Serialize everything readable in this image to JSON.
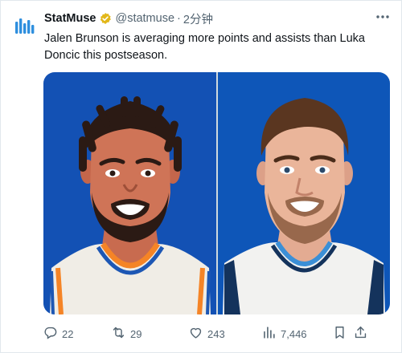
{
  "tweet": {
    "author_name": "StatMuse",
    "handle": "@statmuse",
    "separator": "·",
    "time": "2分钟",
    "text": "Jalen Brunson is averaging more points and assists than Luka Doncic this postseason.",
    "verified_badge_color": "#e2b719",
    "logo_color": "#2f8fde"
  },
  "media": {
    "left_panel": {
      "subject": "Jalen Brunson",
      "background_color": "#1351b4",
      "jersey_colors": [
        "#f0ede6",
        "#f58426",
        "#1d57b4"
      ]
    },
    "right_panel": {
      "subject": "Luka Doncic",
      "background_color": "#0e56b8",
      "jersey_colors": [
        "#f2f2f0",
        "#14335c",
        "#3b8fd6"
      ]
    }
  },
  "actions": {
    "replies": "22",
    "retweets": "29",
    "likes": "243",
    "views": "7,446"
  },
  "icons": [
    "statmuse-logo-icon",
    "verified-badge-icon",
    "more-icon",
    "reply-icon",
    "retweet-icon",
    "like-icon",
    "views-icon",
    "bookmark-icon",
    "share-icon"
  ]
}
